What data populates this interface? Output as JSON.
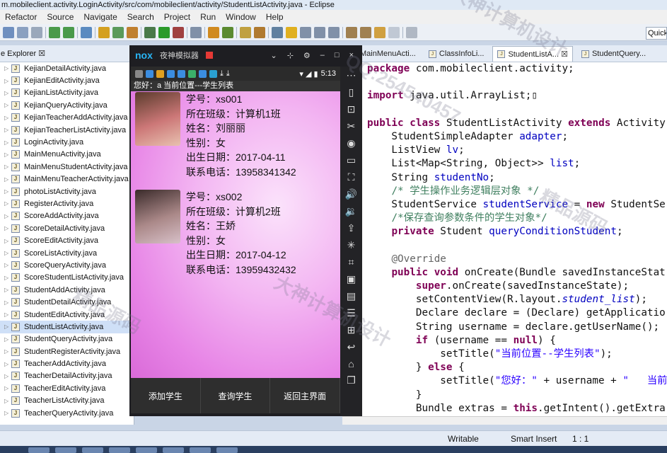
{
  "window": {
    "title": "m.mobileclient.activity.LoginActivity/src/com/mobileclient/activity/StudentListActivity.java - Eclipse"
  },
  "menu": [
    "Refactor",
    "Source",
    "Navigate",
    "Search",
    "Project",
    "Run",
    "Window",
    "Help"
  ],
  "toolbar": {
    "quick_access": "Quick"
  },
  "explorer": {
    "tab_label": "e Explorer ☒",
    "items": [
      "KejianDetailActivity.java",
      "KejianEditActivity.java",
      "KejianListActivity.java",
      "KejianQueryActivity.java",
      "KejianTeacherAddActivity.java",
      "KejianTeacherListActivity.java",
      "LoginActivity.java",
      "MainMenuActivity.java",
      "MainMenuStudentActivity.java",
      "MainMenuTeacherActivity.java",
      "photoListActivity.java",
      "RegisterActivity.java",
      "ScoreAddActivity.java",
      "ScoreDetailActivity.java",
      "ScoreEditActivity.java",
      "ScoreListActivity.java",
      "ScoreQueryActivity.java",
      "ScoreStudentListActivity.java",
      "StudentAddActivity.java",
      "StudentDetailActivity.java",
      "StudentEditActivity.java",
      "StudentListActivity.java",
      "StudentQueryActivity.java",
      "StudentRegisterActivity.java",
      "TeacherAddActivity.java",
      "TeacherDetailActivity.java",
      "TeacherEditActivity.java",
      "TeacherListActivity.java",
      "TeacherQueryActivity.java"
    ],
    "selected": "StudentListActivity.java"
  },
  "emulator": {
    "logo": "nox",
    "title": "夜神模拟器",
    "status_time": "5:13",
    "app_title": "您好：a  当前位置---学生列表",
    "students": [
      {
        "no": "学号：xs001",
        "class": "所在班级：计算机1班",
        "name": "姓名：刘丽丽",
        "gender": "性别：女",
        "birth": "出生日期：2017-04-11",
        "phone": "联系电话：13958341342"
      },
      {
        "no": "学号：xs002",
        "class": "所在班级：计算机2班",
        "name": "姓名：王娇",
        "gender": "性别：女",
        "birth": "出生日期：2017-04-12",
        "phone": "联系电话：13959432432"
      }
    ],
    "bottom_nav": [
      "添加学生",
      "查询学生",
      "返回主界面"
    ]
  },
  "editor": {
    "tabs": [
      "MainMenuActi...",
      "ClassInfoLi...",
      "StudentListA... ☒",
      "StudentQuery..."
    ],
    "active_tab": "StudentListA... ☒"
  },
  "status": {
    "mode": "Writable",
    "insert": "Smart Insert",
    "position": "1 : 1"
  },
  "watermarks": [
    "大神计算机设计",
    "QQ:254540457",
    "精品源码"
  ],
  "colors": {
    "phone_bg": "#ee9aed",
    "keyword": "#7f0055",
    "field": "#0000c0",
    "comment": "#3f7f5f",
    "string": "#2a00ff"
  }
}
